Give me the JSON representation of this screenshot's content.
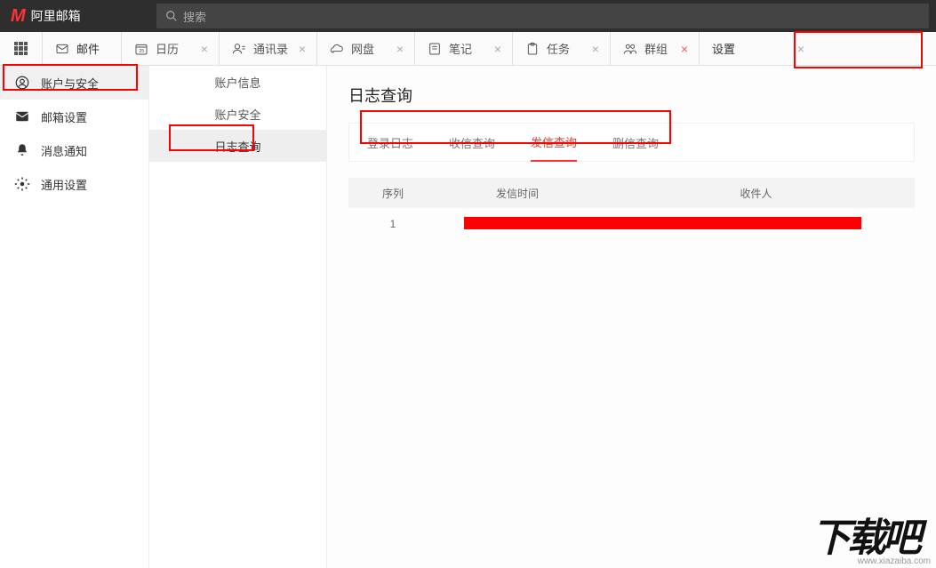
{
  "header": {
    "brand": "阿里邮箱",
    "search_placeholder": "搜索"
  },
  "tabs": {
    "mail": "邮件",
    "items": [
      {
        "label": "日历",
        "icon": "calendar"
      },
      {
        "label": "通讯录",
        "icon": "contacts"
      },
      {
        "label": "网盘",
        "icon": "cloud"
      },
      {
        "label": "笔记",
        "icon": "notes"
      },
      {
        "label": "任务",
        "icon": "tasks"
      },
      {
        "label": "群组",
        "icon": "group"
      },
      {
        "label": "设置",
        "icon": "none"
      }
    ],
    "close_glyph": "×"
  },
  "sidebar": [
    {
      "label": "账户与安全",
      "icon": "user-shield",
      "active": true
    },
    {
      "label": "邮箱设置",
      "icon": "envelope"
    },
    {
      "label": "消息通知",
      "icon": "bell"
    },
    {
      "label": "通用设置",
      "icon": "gear"
    }
  ],
  "subsidebar": [
    {
      "label": "账户信息"
    },
    {
      "label": "账户安全"
    },
    {
      "label": "日志查询",
      "active": true
    }
  ],
  "content": {
    "title": "日志查询",
    "query_tabs": [
      {
        "label": "登录日志"
      },
      {
        "label": "收信查询"
      },
      {
        "label": "发信查询",
        "active": true
      },
      {
        "label": "删信查询"
      }
    ],
    "columns": {
      "seq": "序列",
      "time": "发信时间",
      "rcpt": "收件人"
    },
    "rows": [
      {
        "seq": "1"
      }
    ]
  },
  "watermark": {
    "text": "下载吧",
    "url": "www.xiazaiba.com"
  }
}
